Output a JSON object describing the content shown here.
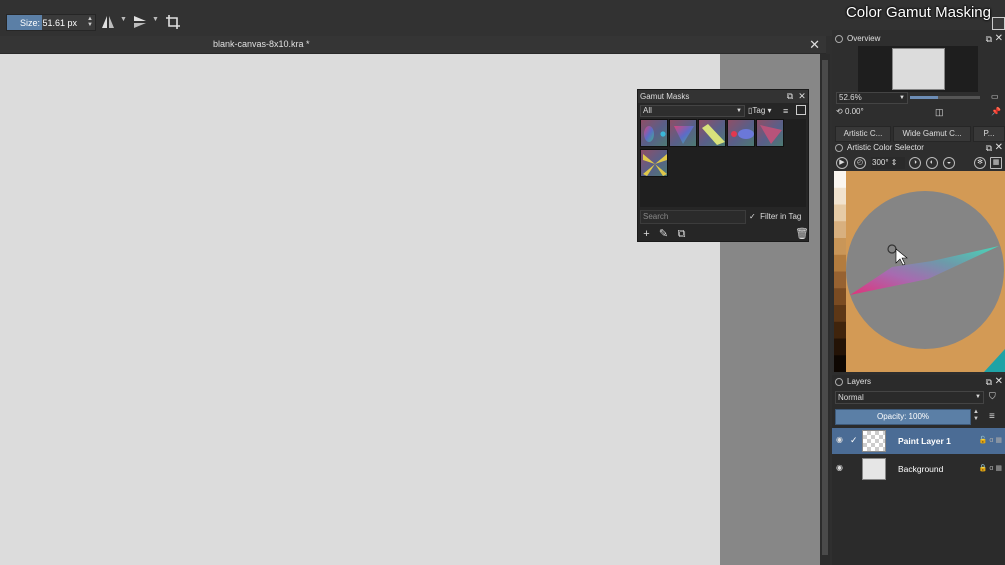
{
  "toolbar": {
    "brush_size": {
      "label": "Size:",
      "value": "51.61 px",
      "fill_fraction": 0.4
    },
    "icons": [
      "horizontal-mirror-icon",
      "vertical-mirror-icon",
      "crop-icon"
    ]
  },
  "workspace": {
    "title": "Color Gamut Masking"
  },
  "document_tab": {
    "title": "blank-canvas-8x10.kra *",
    "close": "✕"
  },
  "gamut_masks": {
    "title": "Gamut Masks",
    "filter_value": "All",
    "tag_label": "Tag",
    "search_placeholder": "Search",
    "filter_in_tag": "Filter in Tag",
    "masks": [
      "mask-1",
      "mask-2",
      "mask-3",
      "mask-4",
      "mask-5",
      "mask-6"
    ]
  },
  "overview": {
    "title": "Overview",
    "zoom": "52.6%",
    "zoom_fraction": 0.4,
    "rotation": "0.00°"
  },
  "docker_tabs": [
    "Artistic C...",
    "Wide Gamut C...",
    "P..."
  ],
  "artistic_color_selector": {
    "title": "Artistic Color Selector",
    "angle": "300°",
    "value_swatches": [
      "#faf6f0",
      "#f1e3cf",
      "#e6cba6",
      "#d8b07f",
      "#c99658",
      "#b37c3e",
      "#976231",
      "#7a4b22",
      "#5d3716",
      "#40240c",
      "#241306",
      "#0e0702"
    ]
  },
  "layers": {
    "title": "Layers",
    "blend_mode": "Normal",
    "opacity_label": "Opacity:  100%",
    "items": [
      {
        "name": "Paint Layer 1",
        "active": true
      },
      {
        "name": "Background",
        "active": false
      }
    ]
  },
  "colors": {
    "accent": "#5b7fa6",
    "canvas": "#dcdcdc",
    "wheel_background": "#d39a55",
    "wheel_disc": "#858585"
  }
}
